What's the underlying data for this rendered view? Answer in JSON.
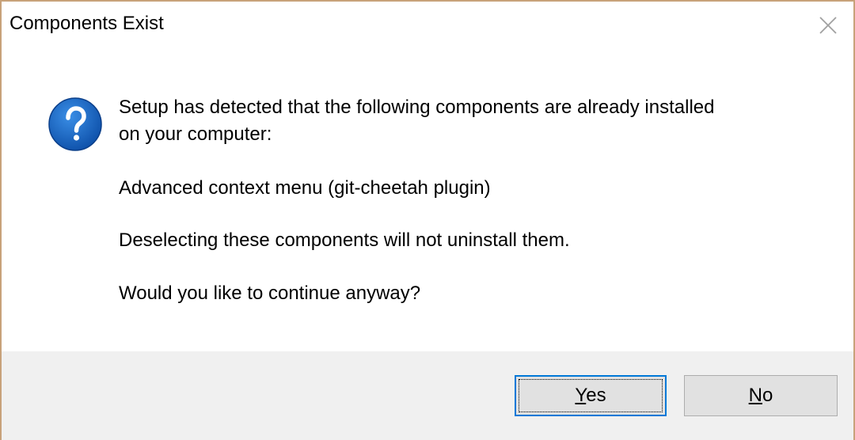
{
  "window": {
    "title": "Components Exist",
    "border_color": "#c8a27a"
  },
  "icons": {
    "question": "question-icon",
    "close": "close-icon"
  },
  "message": {
    "line1": "Setup has detected that the following components are already installed",
    "line2": "on your computer:",
    "component": "Advanced context menu (git-cheetah plugin)",
    "deselect_note": "Deselecting these components will not uninstall them.",
    "question": "Would you like to continue anyway?"
  },
  "buttons": {
    "yes": {
      "mnemonic": "Y",
      "rest": "es"
    },
    "no": {
      "mnemonic": "N",
      "rest": "o"
    }
  },
  "colors": {
    "accent": "#0078d7",
    "footer_bg": "#f0f0f0",
    "button_bg": "#e1e1e1",
    "icon_blue": "#1565c0"
  }
}
